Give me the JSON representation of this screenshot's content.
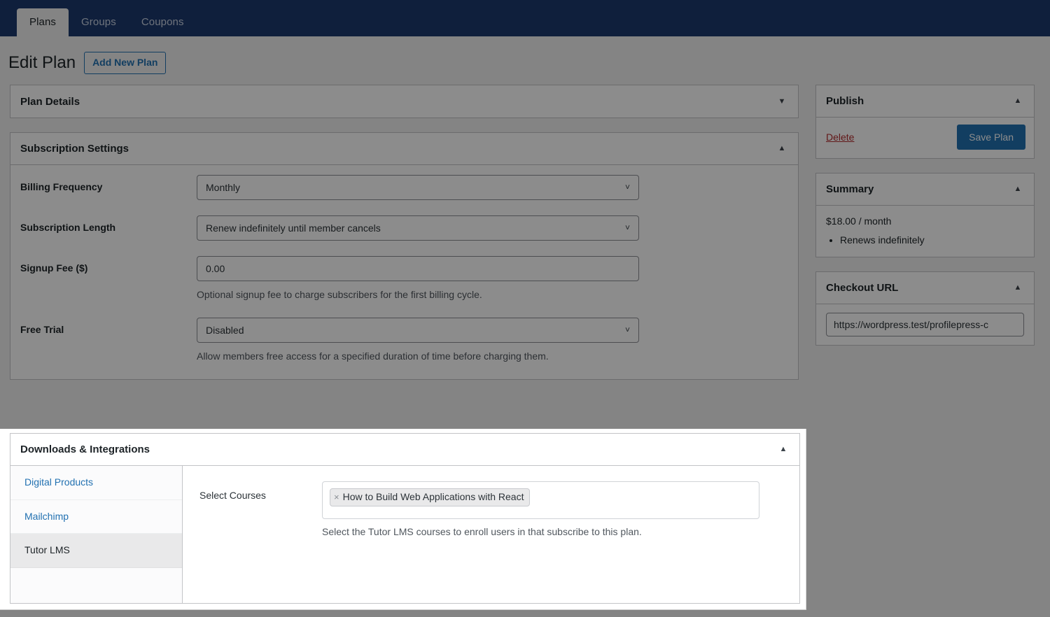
{
  "nav": {
    "tabs": [
      {
        "label": "Plans",
        "active": true
      },
      {
        "label": "Groups",
        "active": false
      },
      {
        "label": "Coupons",
        "active": false
      }
    ]
  },
  "header": {
    "page_title": "Edit Plan",
    "add_new_label": "Add New Plan"
  },
  "panels": {
    "plan_details": {
      "title": "Plan Details",
      "state": "collapsed",
      "toggle_icon": "chevron-down-icon"
    },
    "subscription_settings": {
      "title": "Subscription Settings",
      "state": "expanded",
      "toggle_icon": "chevron-up-icon",
      "fields": [
        {
          "label": "Billing Frequency",
          "type": "select",
          "value": "Monthly",
          "help": ""
        },
        {
          "label": "Subscription Length",
          "type": "select",
          "value": "Renew indefinitely until member cancels",
          "help": ""
        },
        {
          "label": "Signup Fee ($)",
          "type": "text",
          "value": "0.00",
          "help": "Optional signup fee to charge subscribers for the first billing cycle."
        },
        {
          "label": "Free Trial",
          "type": "select",
          "value": "Disabled",
          "help": "Allow members free access for a specified duration of time before charging them."
        }
      ]
    },
    "downloads_integrations": {
      "title": "Downloads & Integrations",
      "state": "expanded",
      "toggle_icon": "chevron-up-icon",
      "tabs": [
        {
          "label": "Digital Products",
          "active": false
        },
        {
          "label": "Mailchimp",
          "active": false
        },
        {
          "label": "Tutor LMS",
          "active": true
        }
      ],
      "select_courses": {
        "label": "Select Courses",
        "tokens": [
          {
            "remove_glyph": "×",
            "label": "How to Build Web Applications with React"
          }
        ],
        "help": "Select the Tutor LMS courses to enroll users in that subscribe to this plan."
      }
    }
  },
  "sidebar": {
    "publish": {
      "title": "Publish",
      "toggle_icon": "chevron-up-icon",
      "delete_label": "Delete",
      "save_label": "Save Plan"
    },
    "summary": {
      "title": "Summary",
      "toggle_icon": "chevron-up-icon",
      "price": "$18.00 / month",
      "items": [
        "Renews indefinitely"
      ]
    },
    "checkout_url": {
      "title": "Checkout URL",
      "toggle_icon": "chevron-up-icon",
      "value": "https://wordpress.test/profilepress-c"
    }
  },
  "colors": {
    "nav_bg": "#1d3a6e",
    "accent_blue": "#2271b1",
    "delete_red": "#b32d2e",
    "panel_border": "#c3c4c7",
    "page_bg": "#f0f0f1",
    "active_tab_bg": "#e9e9ea"
  }
}
